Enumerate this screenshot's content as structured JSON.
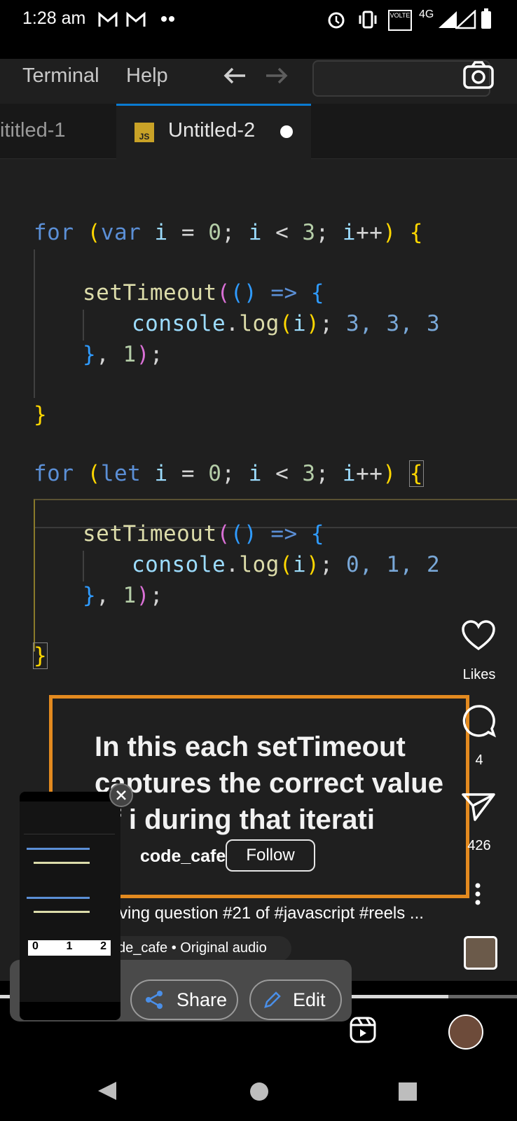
{
  "status_bar": {
    "time": "1:28 am",
    "icons": [
      "gmail-icon",
      "gmail-icon",
      "more-dots-icon",
      "alarm-icon",
      "vibrate-icon",
      "volte-icon",
      "4g-icon",
      "signal-icon",
      "signal-icon",
      "battery-icon"
    ],
    "volte_label": "VOLTE",
    "network_label": "4G"
  },
  "video": {
    "menu": [
      "Terminal",
      "Help"
    ],
    "tabs": [
      {
        "label": "ititled-1",
        "active": false
      },
      {
        "label": "Untitled-2",
        "active": true,
        "badge": "JS"
      }
    ],
    "code_outputs": {
      "var_loop": "3, 3, 3",
      "let_loop": "0, 1, 2"
    }
  },
  "reel": {
    "likes_label": "Likes",
    "comments_count": "4",
    "shares_count": "426",
    "caption_overlay": "In this each setTimeout captures the correct value of i during that iterati",
    "username_fragment": "code_cafe",
    "follow_label": "Follow",
    "description": "ving question #21 of #javascript #reels ...",
    "audio_label": "de_cafe • Original audio"
  },
  "share_sheet": {
    "share_label": "Share",
    "edit_label": "Edit",
    "thumb_values": [
      "0",
      "1",
      "2"
    ]
  },
  "colors": {
    "accent_border": "#e38a1f",
    "tab_accent": "#0a7ad1",
    "background": "#1f1f1f"
  }
}
